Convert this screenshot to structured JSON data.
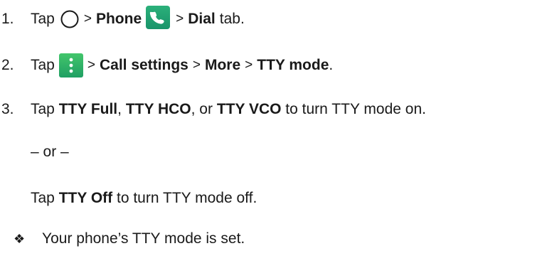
{
  "steps": [
    {
      "num": "1.",
      "tap": "Tap",
      "gt1": ">",
      "phone": "Phone",
      "gt2": ">",
      "dial": "Dial",
      "tab": "tab."
    },
    {
      "num": "2.",
      "tap": "Tap",
      "gt1": ">",
      "call_settings": "Call settings",
      "gt2": ">",
      "more": "More",
      "gt3": ">",
      "tty_mode": "TTY mode",
      "period": "."
    },
    {
      "num": "3.",
      "tap": "Tap",
      "tty_full": "TTY Full",
      "comma1": ",",
      "tty_hco": "TTY HCO",
      "or_text": ", or",
      "tty_vco": "TTY VCO",
      "rest": "to turn TTY mode on."
    }
  ],
  "separator": "– or –",
  "alt_step": {
    "tap": "Tap",
    "tty_off": "TTY Off",
    "rest": "to turn TTY mode off."
  },
  "result": {
    "bullet": "❖",
    "text": "Your phone’s TTY mode is set."
  },
  "icons": {
    "home": "home-circle-icon",
    "phone": "phone-app-icon",
    "menu": "more-options-icon",
    "phone_color": "#1fa06e",
    "menu_color": "#2eb366"
  }
}
